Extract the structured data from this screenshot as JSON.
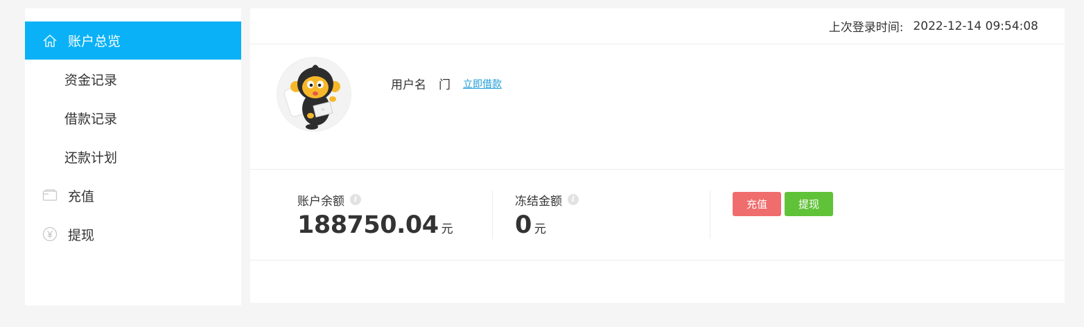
{
  "sidebar": {
    "items": [
      {
        "label": "账户总览",
        "icon": "home-icon",
        "active": true
      },
      {
        "label": "资金记录"
      },
      {
        "label": "借款记录"
      },
      {
        "label": "还款计划"
      },
      {
        "label": "充值",
        "icon": "card-icon"
      },
      {
        "label": "提现",
        "icon": "yen-icon"
      }
    ]
  },
  "header": {
    "last_login_label": "上次登录时间:",
    "last_login_time": "2022-12-14 09:54:08"
  },
  "profile": {
    "username_label": "用户名",
    "username_value": "门",
    "borrow_link": "立即借款"
  },
  "balance": {
    "account": {
      "label": "账户余额",
      "value": "188750.04",
      "unit": "元"
    },
    "frozen": {
      "label": "冻结金额",
      "value": "0",
      "unit": "元"
    }
  },
  "actions": {
    "recharge": "充值",
    "withdraw": "提现"
  },
  "colors": {
    "accent": "#0ab1f6",
    "recharge": "#f06d6d",
    "withdraw": "#60c238",
    "link": "#1b9bd6"
  }
}
